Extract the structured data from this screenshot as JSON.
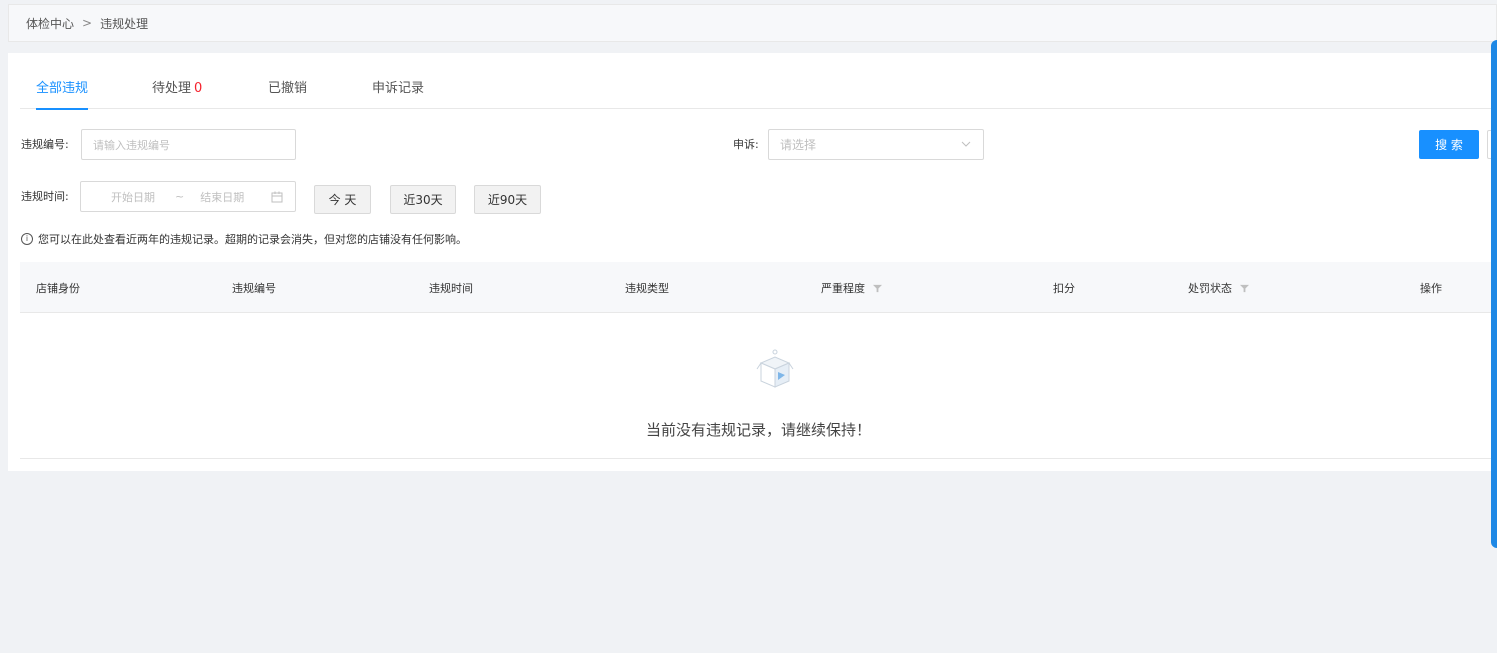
{
  "breadcrumb": {
    "root": "体检中心",
    "separator": ">",
    "current": "违规处理"
  },
  "tabs": [
    {
      "label": "全部违规",
      "count": ""
    },
    {
      "label": "待处理",
      "count": "0"
    },
    {
      "label": "已撤销",
      "count": ""
    },
    {
      "label": "申诉记录",
      "count": ""
    }
  ],
  "filters": {
    "violation_no_label": "违规编号:",
    "violation_no_placeholder": "请输入违规编号",
    "appeal_label": "申诉:",
    "appeal_placeholder": "请选择",
    "time_label": "违规时间:",
    "start_placeholder": "开始日期",
    "range_sep": "~",
    "end_placeholder": "结束日期",
    "today": "今 天",
    "last30": "近30天",
    "last90": "近90天",
    "search": "搜 索"
  },
  "notice": "您可以在此处查看近两年的违规记录。超期的记录会消失，但对您的店铺没有任何影响。",
  "table": {
    "columns": [
      "店铺身份",
      "违规编号",
      "违规时间",
      "违规类型",
      "严重程度",
      "扣分",
      "处罚状态",
      "操作"
    ],
    "empty_text": "当前没有违规记录，请继续保持！"
  },
  "colors": {
    "accent": "#1890ff",
    "count": "#f5222d",
    "side": "#1e88e5"
  }
}
